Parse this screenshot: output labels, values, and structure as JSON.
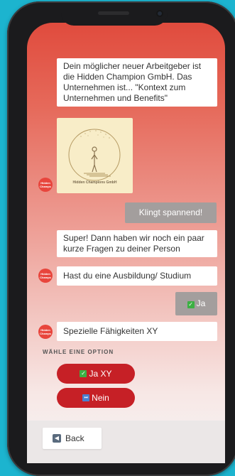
{
  "chat": {
    "messages": [
      {
        "sender": "bot",
        "text": "Dein möglicher neuer Arbeitgeber ist die Hidden Champion GmbH. Das Unternehmen ist... \"Kontext zum Unternehmen und Benefits\""
      },
      {
        "sender": "bot",
        "type": "image",
        "caption": "Hidden Champions GmbH"
      },
      {
        "sender": "user",
        "text": "Klingt spannend!"
      },
      {
        "sender": "bot",
        "text": "Super! Dann haben wir noch ein paar kurze Fragen zu deiner Person"
      },
      {
        "sender": "bot",
        "text": "Hast du eine Ausbildung/ Studium"
      },
      {
        "sender": "user",
        "text": "Ja",
        "emoji": "✓"
      },
      {
        "sender": "bot",
        "text": "Spezielle Fähigkeiten XY"
      }
    ],
    "avatar_text": "Hidden Champs"
  },
  "options": {
    "label": "WÄHLE EINE OPTION",
    "items": [
      {
        "label": "Ja XY",
        "emoji": "✓"
      },
      {
        "label": "Nein",
        "emoji": "⏭"
      }
    ]
  },
  "footer": {
    "back_label": "Back",
    "back_icon": "back-arrow-icon"
  },
  "colors": {
    "background": "#1cb4cf",
    "gradient_top": "#e04b3d",
    "option_button": "#c62026",
    "user_bubble": "#a39e9d"
  }
}
